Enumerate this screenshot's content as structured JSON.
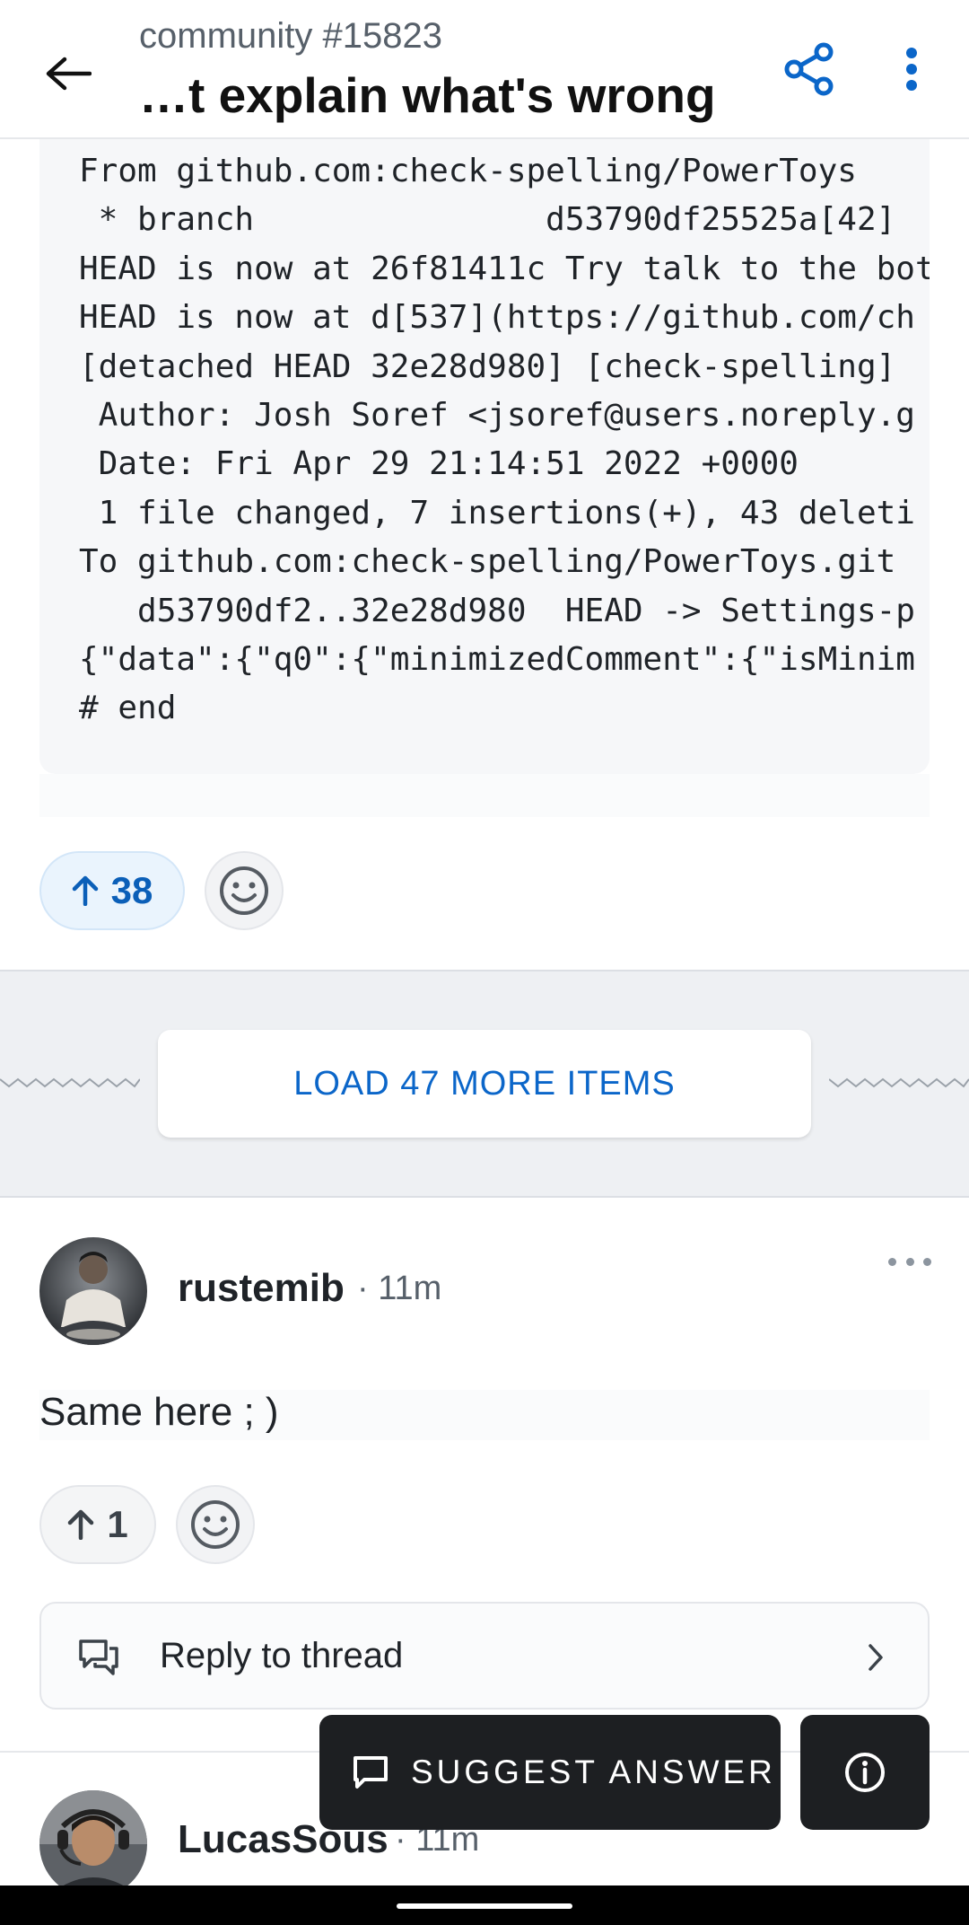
{
  "header": {
    "subtitle": "community #15823",
    "title": "…t explain what's wrong"
  },
  "code": {
    "lines": [
      "From github.com:check-spelling/PowerToys",
      " * branch               d53790df25525a[42]",
      "HEAD is now at 26f81411c Try talk to the bot",
      "HEAD is now at d[537](https://github.com/ch",
      "[detached HEAD 32e28d980] [check-spelling] ",
      " Author: Josh Soref <jsoref@users.noreply.g",
      " Date: Fri Apr 29 21:14:51 2022 +0000",
      " 1 file changed, 7 insertions(+), 43 deleti",
      "To github.com:check-spelling/PowerToys.git",
      "   d53790df2..32e28d980  HEAD -> Settings-p",
      "{\"data\":{\"q0\":{\"minimizedComment\":{\"isMinim",
      "# end"
    ]
  },
  "post_reactions": {
    "upvotes": "38"
  },
  "load_more": {
    "label": "LOAD 47 MORE ITEMS"
  },
  "comment1": {
    "username": "rustemib",
    "time": "· 11m",
    "body": "Same here ; )",
    "upvotes": "1",
    "reply_label": "Reply to thread"
  },
  "comment2": {
    "username": "LucasSous",
    "time": "· 11m"
  },
  "actions": {
    "suggest_label": "SUGGEST ANSWER"
  },
  "colors": {
    "accent": "#0b66c9",
    "dark_button": "#1d1f22"
  }
}
